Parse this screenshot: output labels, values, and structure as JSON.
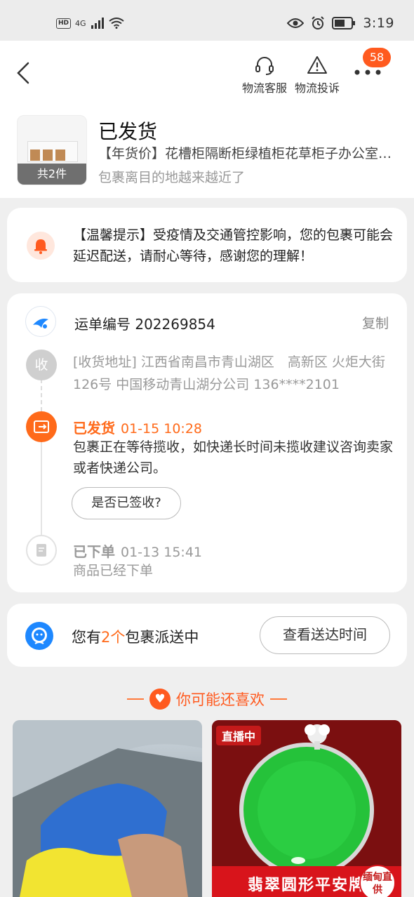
{
  "status_bar": {
    "hd": "HD",
    "network": "4G",
    "time": "3:19"
  },
  "header": {
    "service_label": "物流客服",
    "complaint_label": "物流投诉",
    "more_badge": "58"
  },
  "shipment": {
    "status": "已发货",
    "product_title": "【年货价】花槽柜隔断柜绿植柜花草柜子办公室屏风隔断矮柜",
    "subtitle": "包裹离目的地越来越近了",
    "item_count": "共2件"
  },
  "notice": {
    "text": "【温馨提示】受疫情及交通管控影响，您的包裹可能会延迟配送，请耐心等待，感谢您的理解！"
  },
  "tracking": {
    "waybill": "运单编号 202269854",
    "copy_label": "复制",
    "receive_node": "收",
    "address": "[收货地址] 江西省南昌市青山湖区　高新区 火炬大街126号 中国移动青山湖分公司 136****2101",
    "events": [
      {
        "status": "已发货",
        "time": "01-15 10:28",
        "desc": "包裹正在等待揽收，如快递长时间未揽收建议咨询卖家或者快递公司。"
      },
      {
        "status": "已下单",
        "time": "01-13 15:41",
        "desc": "商品已经下单"
      }
    ],
    "signed_button": "是否已签收?"
  },
  "packages": {
    "prefix": "您有",
    "count": "2个",
    "suffix": "包裹派送中",
    "button": "查看送达时间"
  },
  "recommend": {
    "title": "你可能还喜欢",
    "tiles": [
      {
        "tag": ""
      },
      {
        "tag": "直播中",
        "banner": "翡翠圆形平安牌",
        "corner": "缅甸直供"
      }
    ]
  },
  "colors": {
    "accent": "#ff6a1a",
    "badge": "#ff5a1f",
    "muted": "#999999"
  }
}
